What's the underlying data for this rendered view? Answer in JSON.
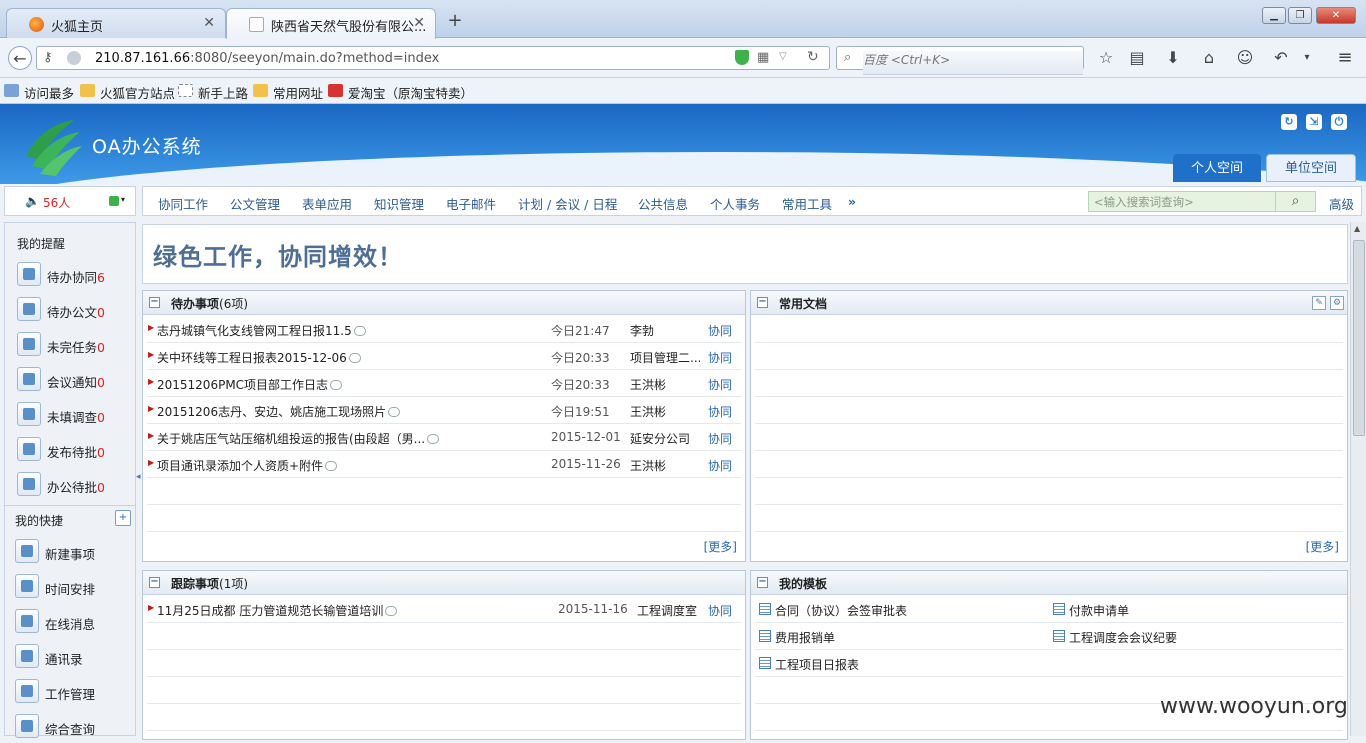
{
  "browser": {
    "tabs": [
      {
        "title": "火狐主页"
      },
      {
        "title": "陕西省天然气股份有限公..."
      }
    ],
    "new_tab": "+",
    "url_host": "210.87.161.66",
    "url_rest": ":8080/seeyon/main.do?method=index",
    "search_placeholder": "百度 <Ctrl+K>",
    "bookmarks": [
      "访问最多",
      "火狐官方站点",
      "新手上路",
      "常用网址",
      "爱淘宝（原淘宝特卖）"
    ]
  },
  "app": {
    "name": "OA办公系统",
    "space_tabs": [
      "个人空间",
      "单位空间"
    ],
    "online_count": "56人",
    "menu": [
      "协同工作",
      "公文管理",
      "表单应用",
      "知识管理",
      "电子邮件",
      "计划 / 会议 / 日程",
      "公共信息",
      "个人事务",
      "常用工具",
      "»"
    ],
    "search_placeholder": "<输入搜索词查询>",
    "advanced": "高级"
  },
  "sidebar": {
    "reminders_title": "我的提醒",
    "reminders": [
      {
        "label": "待办协同",
        "count": "6"
      },
      {
        "label": "待办公文",
        "count": "0"
      },
      {
        "label": "未完任务",
        "count": "0"
      },
      {
        "label": "会议通知",
        "count": "0"
      },
      {
        "label": "未填调查",
        "count": "0"
      },
      {
        "label": "发布待批",
        "count": "0"
      },
      {
        "label": "办公待批",
        "count": "0"
      }
    ],
    "shortcuts_title": "我的快捷",
    "shortcuts": [
      "新建事项",
      "时间安排",
      "在线消息",
      "通讯录",
      "工作管理",
      "综合查询"
    ]
  },
  "main": {
    "slogan": "绿色工作，协同增效！",
    "pending": {
      "title": "待办事项",
      "count": "(6项)",
      "items": [
        {
          "title": "志丹城镇气化支线管网工程日报11.5",
          "date": "今日21:47",
          "sender": "李勃",
          "kind": "协同"
        },
        {
          "title": "关中环线等工程日报表2015-12-06",
          "date": "今日20:33",
          "sender": "项目管理二...",
          "kind": "协同"
        },
        {
          "title": "20151206PMC项目部工作日志",
          "date": "今日20:33",
          "sender": "王洪彬",
          "kind": "协同"
        },
        {
          "title": "20151206志丹、安边、姚店施工现场照片",
          "date": "今日19:51",
          "sender": "王洪彬",
          "kind": "协同"
        },
        {
          "title": "关于姚店压气站压缩机组投运的报告(由段超（男...",
          "date": "2015-12-01",
          "sender": "延安分公司",
          "kind": "协同"
        },
        {
          "title": "项目通讯录添加个人资质+附件",
          "date": "2015-11-26",
          "sender": "王洪彬",
          "kind": "协同"
        }
      ],
      "more": "[更多]"
    },
    "docs": {
      "title": "常用文档",
      "more": "[更多]"
    },
    "tracking": {
      "title": "跟踪事项",
      "count": "(1项)",
      "items": [
        {
          "title": "11月25日成都 压力管道规范长输管道培训",
          "date": "2015-11-16",
          "sender": "工程调度室",
          "kind": "协同"
        }
      ]
    },
    "templates": {
      "title": "我的模板",
      "items": [
        "合同（协议）会签审批表",
        "付款申请单",
        "费用报销单",
        "工程调度会会议纪要",
        "工程项目日报表"
      ]
    }
  },
  "watermark": "www.wooyun.org"
}
